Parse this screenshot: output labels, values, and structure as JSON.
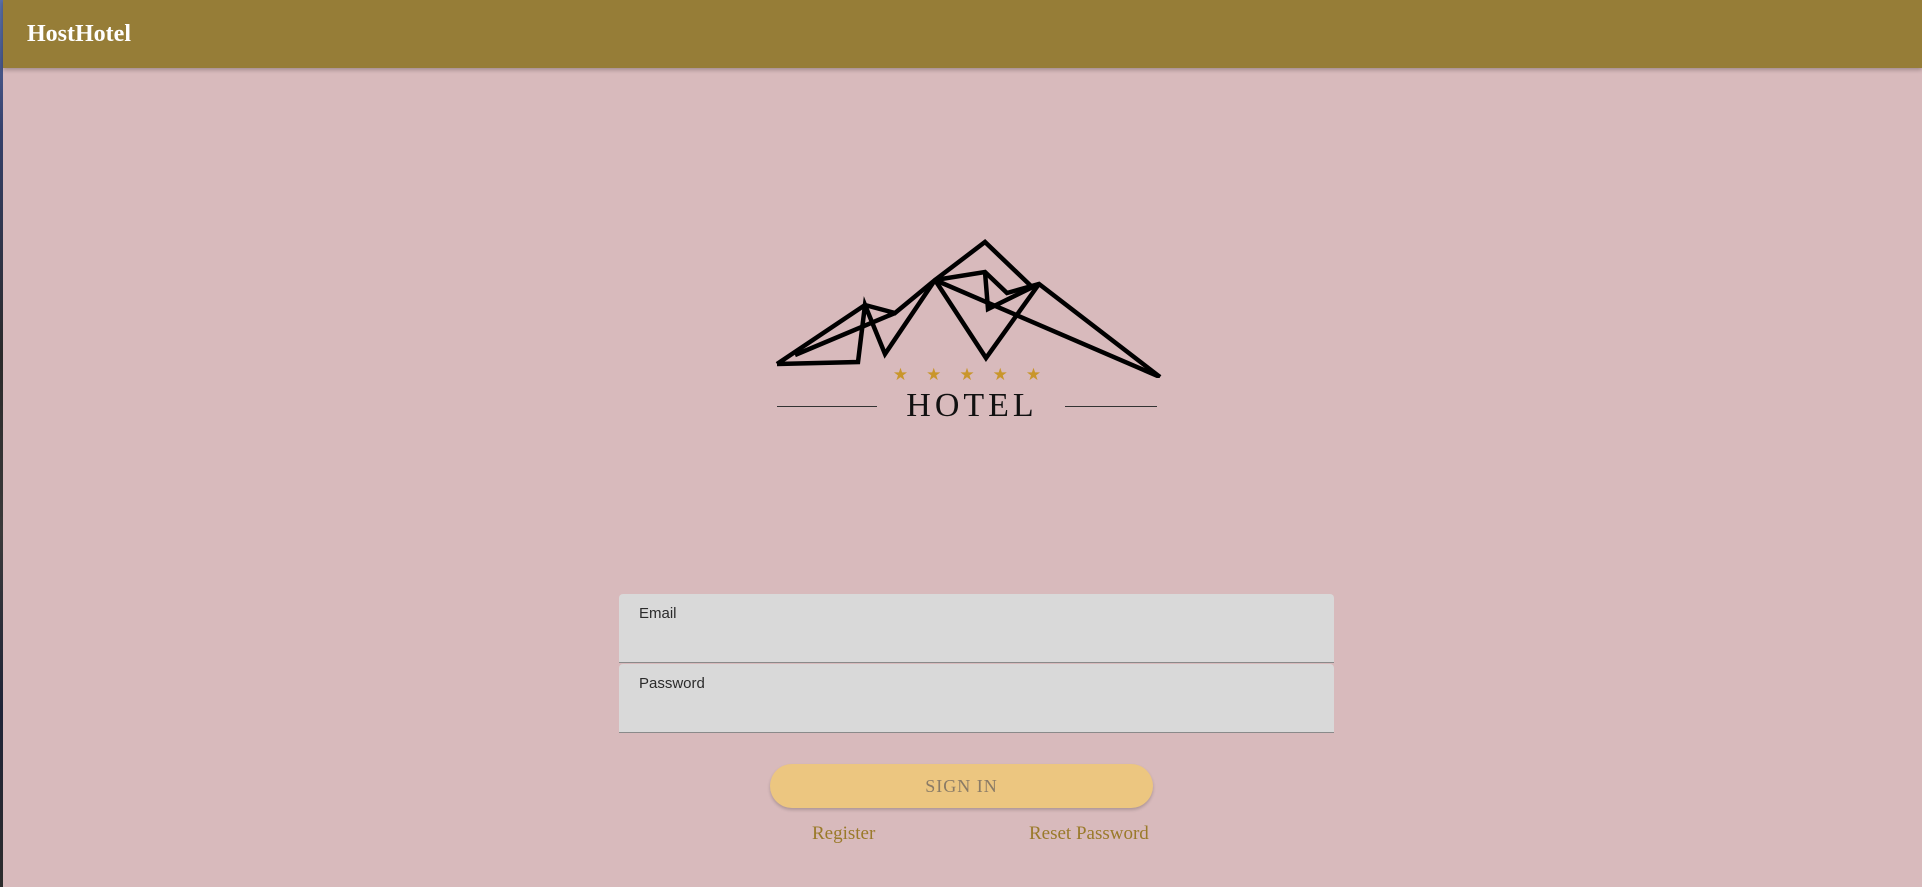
{
  "app": {
    "brand": "HostHotel"
  },
  "logo": {
    "stars": "★★★★★",
    "word": "HOTEL",
    "star_color": "#c9962b"
  },
  "form": {
    "email_label": "Email",
    "email_value": "",
    "password_label": "Password",
    "password_value": ""
  },
  "actions": {
    "signin_label": "SIGN IN",
    "register_label": "Register",
    "reset_label": "Reset Password"
  },
  "colors": {
    "topbar": "#967d37",
    "background": "#d8babc",
    "button": "#ecc680",
    "link": "#9a7a2a"
  }
}
